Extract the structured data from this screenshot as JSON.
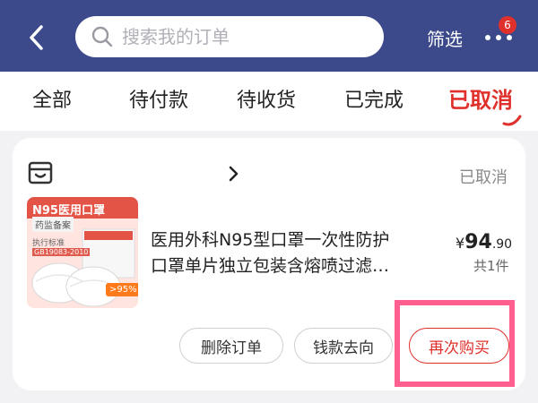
{
  "colors": {
    "header_bg": "#3c4a8c",
    "accent": "#e0302b",
    "highlight": "#ff5f8f"
  },
  "header": {
    "search_placeholder": "搜索我的订单",
    "filter_label": "筛选",
    "notification_count": "6",
    "icons": [
      "chevron-left-icon",
      "search-icon",
      "more-dots-icon"
    ]
  },
  "tabs": [
    {
      "label": "全部",
      "active": false
    },
    {
      "label": "待付款",
      "active": false
    },
    {
      "label": "待收货",
      "active": false
    },
    {
      "label": "已完成",
      "active": false
    },
    {
      "label": "已取消",
      "active": true
    }
  ],
  "order": {
    "status": "已取消",
    "shop_icon": "shop-icon",
    "product": {
      "image_text": {
        "n95": "N95医用口罩",
        "tag": "药监备案",
        "std1": "执行标准",
        "std2": "GB19083-2010",
        "pct": ">95%"
      },
      "title_line1": "医用外科N95型口罩一次性防护",
      "title_line2": "口罩单片独立包装含熔喷过滤…",
      "price_currency": "¥",
      "price_int": "94",
      "price_dec": ".90",
      "quantity": "共1件"
    },
    "actions": {
      "delete": "删除订单",
      "refund": "钱款去向",
      "rebuy": "再次购买"
    }
  }
}
